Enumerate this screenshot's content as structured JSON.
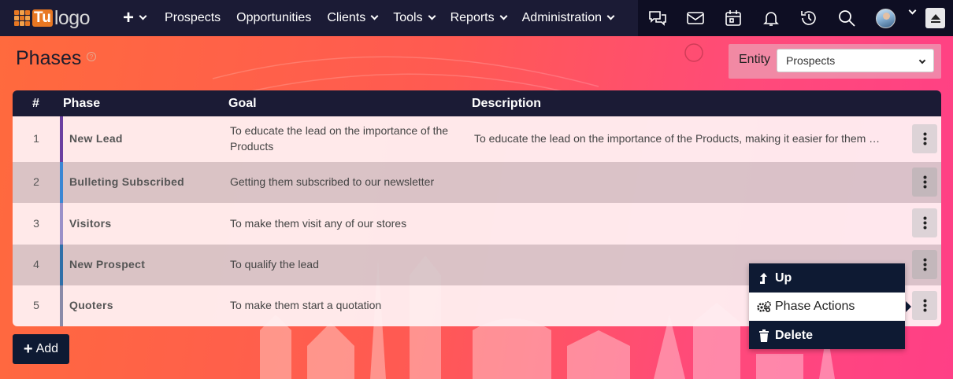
{
  "brand": {
    "logo_mark": "Tu",
    "logo_text": "logo"
  },
  "nav": {
    "plus_symbol": "+",
    "items": [
      {
        "label": "Prospects",
        "has_dropdown": false
      },
      {
        "label": "Opportunities",
        "has_dropdown": false
      },
      {
        "label": "Clients",
        "has_dropdown": true
      },
      {
        "label": "Tools",
        "has_dropdown": true
      },
      {
        "label": "Reports",
        "has_dropdown": true
      },
      {
        "label": "Administration",
        "has_dropdown": true
      }
    ],
    "icons": [
      "chat-icon",
      "mail-icon",
      "calendar-icon",
      "bell-icon",
      "history-icon",
      "search-icon",
      "avatar",
      "scroll-top-icon"
    ]
  },
  "page": {
    "title": "Phases",
    "help_symbol": "?"
  },
  "entity": {
    "label": "Entity",
    "selected": "Prospects"
  },
  "table": {
    "headers": {
      "num": "#",
      "phase": "Phase",
      "goal": "Goal",
      "description": "Description"
    },
    "rows": [
      {
        "num": "1",
        "phase": "New Lead",
        "goal": "To educate the lead on the importance of the Products",
        "description": "To educate the lead on the importance of the Products, making it easier for them …",
        "color": "#6b3fa0"
      },
      {
        "num": "2",
        "phase": "Bulleting Subscribed",
        "goal": "Getting them subscribed to our newsletter",
        "description": "",
        "color": "#3a86d4"
      },
      {
        "num": "3",
        "phase": "Visitors",
        "goal": "To make them visit any of our stores",
        "description": "",
        "color": "#9a90c8"
      },
      {
        "num": "4",
        "phase": "New Prospect",
        "goal": "To qualify the lead",
        "description": "",
        "color": "#2f6fa8"
      },
      {
        "num": "5",
        "phase": "Quoters",
        "goal": "To make them start a quotation",
        "description": "",
        "color": "#8a8aa8"
      }
    ]
  },
  "menu": {
    "items": [
      {
        "label": "Up",
        "icon": "arrow-up-icon"
      },
      {
        "label": "Phase Actions",
        "icon": "gears-icon"
      },
      {
        "label": "Delete",
        "icon": "trash-icon"
      }
    ]
  },
  "add_button": {
    "label": "Add",
    "symbol": "+"
  },
  "colors": {
    "navbar": "#1b1b35",
    "navbar_right": "#0e0e23",
    "menu_bg": "#0e1a33",
    "accent_orange": "#e87722"
  }
}
